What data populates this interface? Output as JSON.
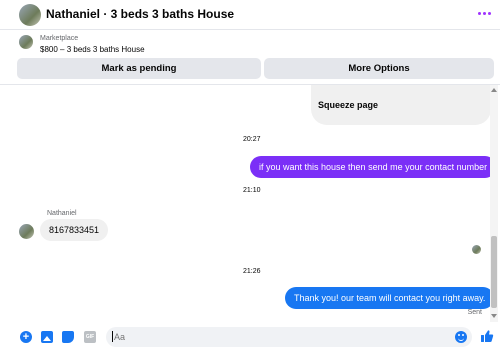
{
  "header": {
    "title": "Nathaniel · 3 beds 3 baths House",
    "avatar_icon": "house-photo-avatar",
    "more_icon": "more-options-dots-icon",
    "accent_color": "#a033ff"
  },
  "marketplace": {
    "label": "Marketplace",
    "item": "$800 – 3 beds 3 baths House",
    "mark_pending_label": "Mark as pending",
    "more_options_label": "More Options"
  },
  "messages": {
    "squeeze_text": "Squeeze page",
    "timestamp_1": "20:27",
    "outgoing_1": "if you want this house then send me your contact number",
    "timestamp_2": "21:10",
    "sender_name": "Nathaniel",
    "incoming_1": "8167833451",
    "timestamp_3": "21:26",
    "outgoing_2": "Thank you! our team will contact you right away.",
    "status": "Sent",
    "outgoing_color_1": "#7b2ff7",
    "outgoing_color_2": "#1877f2"
  },
  "composer": {
    "placeholder": "Aa",
    "icons": [
      "plus-icon",
      "image-icon",
      "sticker-icon",
      "gif-icon",
      "emoji-icon",
      "thumbs-up-icon"
    ],
    "gif_text": "GIF",
    "plus_text": "+"
  }
}
